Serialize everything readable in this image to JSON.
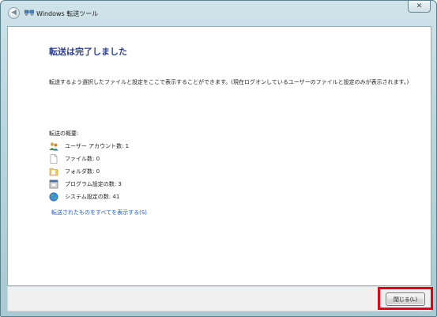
{
  "window": {
    "title": "Windows 転送ツール",
    "back_glyph": "◀",
    "close_glyph": "✕"
  },
  "main": {
    "heading": "転送は完了しました",
    "description": "転送するよう選択したファイルと設定をここで表示することができます。(現在ログオンしているユーザーのファイルと設定のみが表示されます。)",
    "summary_label": "転送の概要:",
    "summary_items": [
      {
        "icon": "users-icon",
        "label": "ユーザー アカウント数: 1"
      },
      {
        "icon": "file-icon",
        "label": "ファイル数: 0"
      },
      {
        "icon": "folder-icon",
        "label": "フォルダ数: 0"
      },
      {
        "icon": "program-icon",
        "label": "プログラム設定の数: 3"
      },
      {
        "icon": "globe-icon",
        "label": "システム設定の数: 41"
      }
    ],
    "view_link": "転送されたものをすべてを表示する(S)"
  },
  "footer": {
    "close_button_label": "閉じる(L)",
    "highlight_color": "#e60012"
  }
}
